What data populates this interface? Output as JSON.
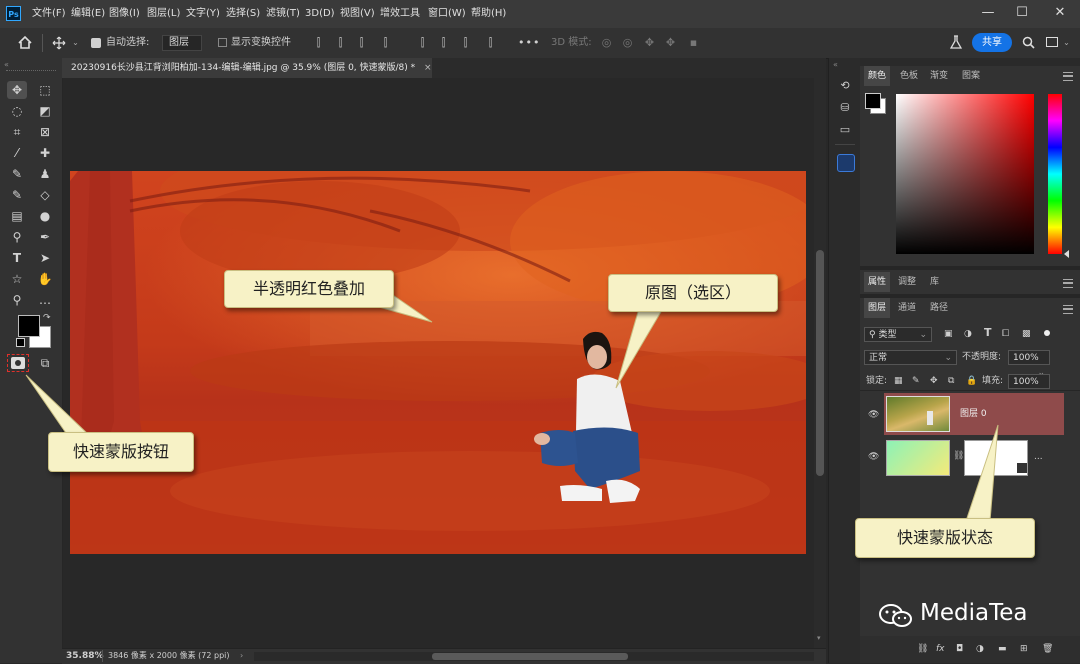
{
  "app": {
    "logo": "Ps"
  },
  "menu": [
    "文件(F)",
    "编辑(E)",
    "图像(I)",
    "图层(L)",
    "文字(Y)",
    "选择(S)",
    "滤镜(T)",
    "3D(D)",
    "视图(V)",
    "增效工具",
    "窗口(W)",
    "帮助(H)"
  ],
  "window_controls": {
    "minimize": "—",
    "maximize": "☐",
    "close": "✕"
  },
  "options": {
    "auto_select_label": "自动选择:",
    "auto_select_value": "图层",
    "show_transform_label": "显示变换控件",
    "mode_3d_label": "3D 模式:",
    "more": "•••",
    "share_label": "共享"
  },
  "document": {
    "tab_title": "20230916长沙县江背浏阳柏加-134-编辑-编辑.jpg @ 35.9% (图层 0, 快速蒙版/8) *",
    "close": "×"
  },
  "status": {
    "zoom": "35.88%",
    "info": "3846 像素 x 2000 像素 (72 ppi)",
    "arrow": "›"
  },
  "color_panel": {
    "tabs": [
      "颜色",
      "色板",
      "渐变",
      "图案"
    ],
    "active_tab": 0,
    "foreground": "#000000",
    "background": "#ffffff",
    "hue_color": "#ff0000"
  },
  "properties_panel": {
    "tabs": [
      "属性",
      "调整",
      "库"
    ],
    "active_tab": 0
  },
  "layers_panel": {
    "tabs": [
      "图层",
      "通道",
      "路径"
    ],
    "active_tab": 0,
    "filter_label": "类型",
    "blend_mode": "正常",
    "opacity_label": "不透明度:",
    "opacity_value": "100%",
    "lock_label": "锁定:",
    "fill_label": "填充:",
    "fill_value": "100%",
    "layers": [
      {
        "name": "图层 0",
        "selected": true
      },
      {
        "name": "...",
        "selected": false
      }
    ]
  },
  "callouts": {
    "overlay": "半透明红色叠加",
    "original": "原图（选区）",
    "quick_mask_button": "快速蒙版按钮",
    "quick_mask_state": "快速蒙版状态"
  },
  "watermark": {
    "text": "MediaTea"
  },
  "colors": {
    "accent_blue": "#1473e6",
    "overlay_red": "#c83218",
    "callout_bg": "#f7f2c6",
    "selected_layer": "#8f4b4b"
  }
}
